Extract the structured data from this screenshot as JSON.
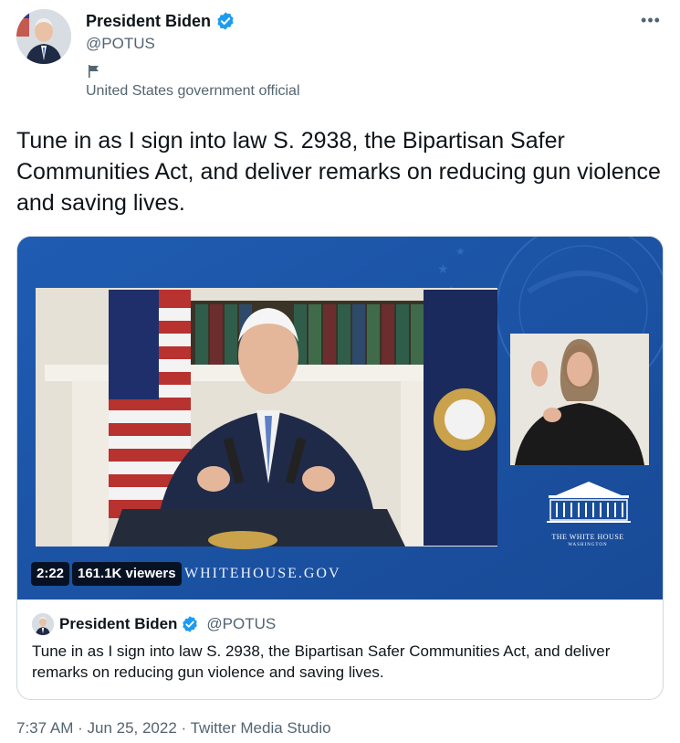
{
  "author": {
    "name": "President Biden",
    "handle": "@POTUS",
    "label": "United States government official",
    "verified": true,
    "avatar_icon": "profile-photo"
  },
  "more_icon": "more-dots-icon",
  "tweet": {
    "text": "Tune in as I sign into law S. 2938, the Bipartisan Safer Communities Act, and deliver remarks on reducing gun violence and saving lives."
  },
  "media": {
    "duration": "2:22",
    "viewers": "161.1K viewers",
    "site": "WHITEHOUSE.GOV",
    "logo_title": "THE WHITE HOUSE",
    "logo_subtitle": "WASHINGTON",
    "background_color": "#1d56a8"
  },
  "quoted_tweet": {
    "name": "President Biden",
    "handle": "@POTUS",
    "text": "Tune in as I sign into law S. 2938, the Bipartisan Safer Communities Act, and deliver remarks on reducing gun violence and saving lives."
  },
  "meta": {
    "time": "7:37 AM",
    "separator": " · ",
    "date": "Jun 25, 2022",
    "source": "Twitter Media Studio"
  },
  "colors": {
    "verified_blue": "#1d9bf0",
    "secondary_text": "#536471",
    "border": "#cfd9de"
  }
}
